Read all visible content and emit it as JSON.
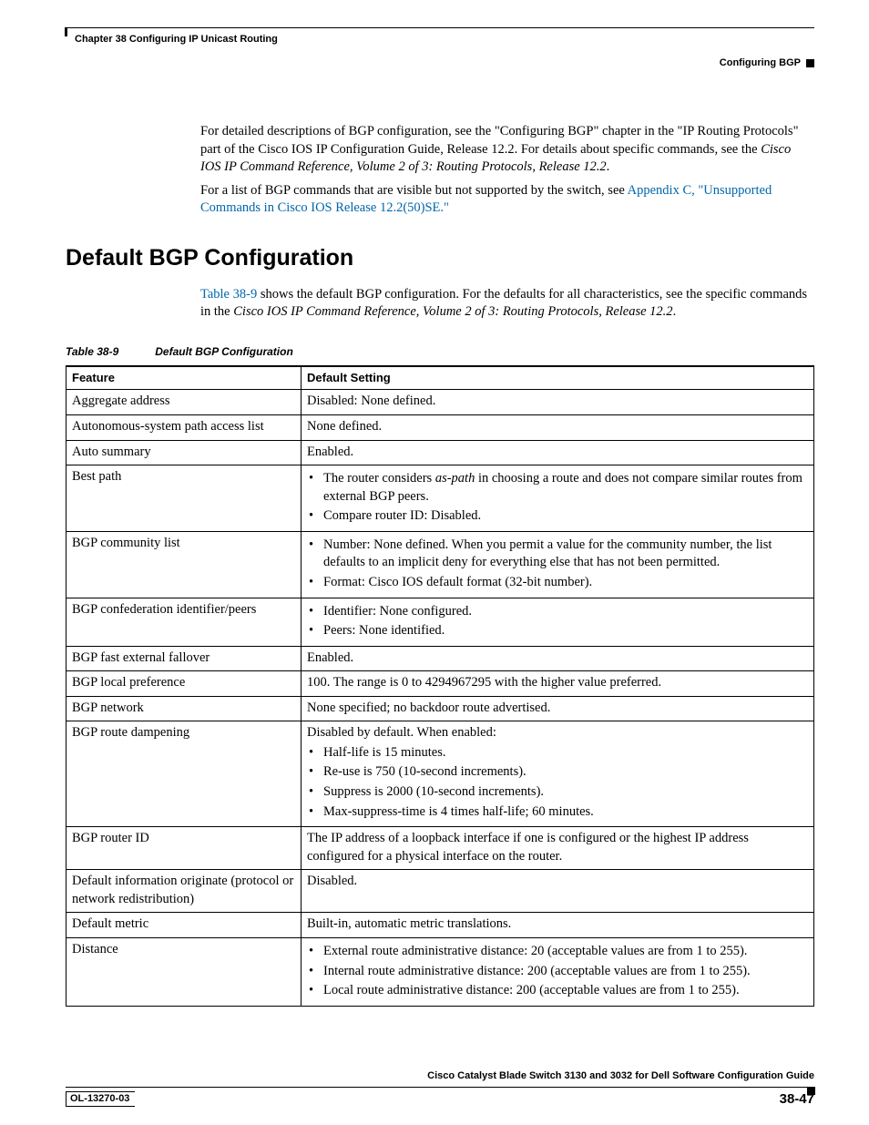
{
  "header": {
    "chapter": "Chapter 38    Configuring IP Unicast Routing",
    "section": "Configuring BGP"
  },
  "intro": {
    "p1a": "For detailed descriptions of BGP configuration, see the \"Configuring BGP\" chapter in the \"IP Routing Protocols\" part of the Cisco IOS IP Configuration Guide, Release 12.2. For details about specific commands, see the ",
    "p1b": "Cisco IOS IP Command Reference, Volume 2 of 3: Routing Protocols, Release 12.2",
    "p1c": ".",
    "p2a": "For a list of BGP commands that are visible but not supported by the switch, see ",
    "p2link": "Appendix C, \"Unsupported Commands in Cisco IOS Release 12.2(50)SE.\""
  },
  "heading": "Default BGP Configuration",
  "lead": {
    "linkText": "Table 38-9",
    "rest": " shows the default BGP configuration. For the defaults for all characteristics, see the specific commands in the ",
    "ital": "Cisco IOS IP Command Reference, Volume 2 of 3: Routing Protocols, Release 12.2",
    "dot": "."
  },
  "table": {
    "number": "Table 38-9",
    "title": "Default BGP Configuration",
    "colFeature": "Feature",
    "colSetting": "Default Setting"
  },
  "rows": {
    "r0f": "Aggregate address",
    "r0s": "Disabled: None defined.",
    "r1f": "Autonomous-system path access list",
    "r1s": "None defined.",
    "r2f": "Auto summary",
    "r2s": "Enabled.",
    "r3f": "Best path",
    "r3b1a": "The router considers ",
    "r3b1i": "as-path",
    "r3b1b": " in choosing a route and does not compare similar routes from external BGP peers.",
    "r3b2": "Compare router ID: Disabled.",
    "r4f": "BGP community list",
    "r4b1": "Number: None defined. When you permit a value for the community number, the list defaults to an implicit deny for everything else that has not been permitted.",
    "r4b2": "Format: Cisco IOS default format (32-bit number).",
    "r5f": "BGP confederation identifier/peers",
    "r5b1": "Identifier: None configured.",
    "r5b2": "Peers: None identified.",
    "r6f": "BGP fast external fallover",
    "r6s": "Enabled.",
    "r7f": "BGP local preference",
    "r7s": "100. The range is 0 to 4294967295 with the higher value preferred.",
    "r8f": "BGP network",
    "r8s": "None specified; no backdoor route advertised.",
    "r9f": "BGP route dampening",
    "r9s": "Disabled by default. When enabled:",
    "r9b1": "Half-life is 15 minutes.",
    "r9b2": "Re-use is 750 (10-second increments).",
    "r9b3": "Suppress is 2000 (10-second increments).",
    "r9b4": "Max-suppress-time is 4 times half-life; 60 minutes.",
    "r10f": "BGP router ID",
    "r10s": "The IP address of a loopback interface if one is configured or the highest IP address configured for a physical interface on the router.",
    "r11f": "Default information originate (protocol or network redistribution)",
    "r11s": "Disabled.",
    "r12f": "Default metric",
    "r12s": "Built-in, automatic metric translations.",
    "r13f": "Distance",
    "r13b1": "External route administrative distance: 20 (acceptable values are from 1 to 255).",
    "r13b2": "Internal route administrative distance: 200 (acceptable values are from 1 to 255).",
    "r13b3": "Local route administrative distance: 200 (acceptable values are from 1 to 255)."
  },
  "footer": {
    "bookTitle": "Cisco Catalyst Blade Switch 3130 and 3032 for Dell Software Configuration Guide",
    "docId": "OL-13270-03",
    "pageNum": "38-47"
  }
}
